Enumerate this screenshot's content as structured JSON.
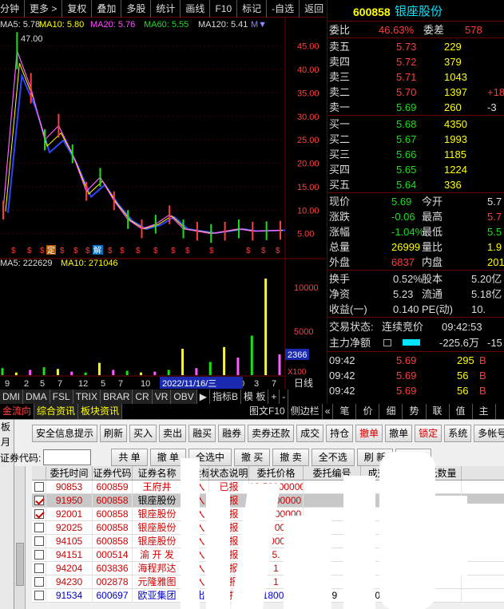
{
  "topbar": {
    "items": [
      "分钟",
      "更多 >",
      "复权",
      "叠加",
      "多股",
      "统计",
      "画线",
      "F10",
      "标记",
      "-自选",
      "返回"
    ]
  },
  "ma": {
    "ma5": "MA5: 5.78",
    "ma10": "MA10: 5.80",
    "ma20": "MA20: 5.76",
    "ma60": "MA60: 5.55",
    "ma120": "MA120: 5.41",
    "more": "M▼"
  },
  "chart_data": {
    "type": "line",
    "price_high_label": "47.00",
    "yaxis_price": [
      "45.00",
      "40.00",
      "35.00",
      "30.00",
      "25.00",
      "20.00",
      "15.00",
      "10.00",
      "5.00"
    ],
    "yaxis_volume": [
      "10000",
      "5000",
      "2366"
    ],
    "volume_unit": "X100",
    "vol_ma": {
      "ma5": "MA5: 222629",
      "ma10": "MA10: 271046"
    },
    "xaxis": [
      "9",
      "2",
      "5",
      "7",
      "12",
      "5",
      "7",
      "10",
      "12",
      "5",
      "7",
      "10",
      "3",
      "7"
    ],
    "date_label": "2022/11/16/三",
    "period_label": "日线",
    "marker_label_ding": "定",
    "marker_label_jie": "解",
    "price_series": [
      10,
      44,
      36,
      25,
      28,
      22,
      14,
      17,
      12,
      8,
      6,
      7,
      9,
      6,
      5.5,
      5,
      5.5,
      6,
      5.5,
      5.6,
      5.7
    ],
    "volume_series": [
      800,
      300,
      600,
      900,
      700,
      400,
      300,
      1400,
      600,
      500,
      300,
      400,
      600,
      3000,
      800,
      1500,
      3200,
      2000,
      4500,
      11000,
      2366
    ]
  },
  "ctrlbar": {
    "items": [
      "DMI",
      "DMA",
      "FSL",
      "TRIX",
      "BRAR",
      "CR",
      "VR",
      "OBV",
      "▶",
      "指标B",
      "模 板",
      "+",
      "-"
    ]
  },
  "tabbar": {
    "items": [
      "金流向",
      "综合资讯",
      "板块资讯",
      "图文F10",
      "侧边栏",
      "«",
      "笔",
      "价",
      "细",
      "势",
      "联",
      "值",
      "主"
    ]
  },
  "quote": {
    "code": "600858",
    "name": "银座股份",
    "weibi_label": "委比",
    "weibi_value": "46.63%",
    "weicha_label": "委差",
    "weicha_value": "578",
    "asks": [
      {
        "label": "卖五",
        "price": "5.73",
        "vol": "229",
        "chg": ""
      },
      {
        "label": "卖四",
        "price": "5.72",
        "vol": "379",
        "chg": ""
      },
      {
        "label": "卖三",
        "price": "5.71",
        "vol": "1043",
        "chg": ""
      },
      {
        "label": "卖二",
        "price": "5.70",
        "vol": "1397",
        "chg": "+18"
      },
      {
        "label": "卖一",
        "price": "5.69",
        "vol": "260",
        "chg": "-3"
      }
    ],
    "bids": [
      {
        "label": "买一",
        "price": "5.68",
        "vol": "4350"
      },
      {
        "label": "买二",
        "price": "5.67",
        "vol": "1993"
      },
      {
        "label": "买三",
        "price": "5.66",
        "vol": "1185"
      },
      {
        "label": "买四",
        "price": "5.65",
        "vol": "1224"
      },
      {
        "label": "买五",
        "price": "5.64",
        "vol": "336"
      }
    ],
    "stats": [
      {
        "l1": "现价",
        "v1": "5.69",
        "l2": "今开",
        "v2": "5.7"
      },
      {
        "l1": "涨跌",
        "v1": "-0.06",
        "l2": "最高",
        "v2": "5.7"
      },
      {
        "l1": "涨幅",
        "v1": "-1.04%",
        "l2": "最低",
        "v2": "5.5"
      },
      {
        "l1": "总量",
        "v1": "26999",
        "l2": "量比",
        "v2": "1.9"
      },
      {
        "l1": "外盘",
        "v1": "6837",
        "l2": "内盘",
        "v2": "2016"
      }
    ],
    "stats2": [
      {
        "l1": "换手",
        "v1": "0.52%",
        "l2": "股本",
        "v2": "5.20亿"
      },
      {
        "l1": "净资",
        "v1": "5.23",
        "l2": "流通",
        "v2": "5.18亿"
      },
      {
        "l1": "收益(一)",
        "v1": "0.140",
        "l2": "PE(动)",
        "v2": "10."
      }
    ],
    "trade_status_label": "交易状态:",
    "trade_status_value": "连续竞价",
    "trade_status_time": "09:42:53",
    "mainflow_label": "主力净额",
    "mainflow_value": "-225.6万",
    "mainflow_extra": "-15",
    "ticks": [
      {
        "time": "09:42",
        "price": "5.69",
        "vol": "295",
        "dir": "B"
      },
      {
        "time": "09:42",
        "price": "5.69",
        "vol": "56",
        "dir": "B"
      },
      {
        "time": "09:42",
        "price": "5.69",
        "vol": "56",
        "dir": "B"
      }
    ]
  },
  "trade": {
    "leftstrip": [
      "板",
      "月"
    ],
    "buttons1": [
      "安全信息提示",
      "刷新",
      "买入",
      "卖出",
      "融买",
      "融券",
      "卖券还款",
      "成交",
      "持仓",
      "撤单",
      "撤单",
      "锁定",
      "系统",
      "多帐号"
    ],
    "code_label": "证券代码:",
    "code_value": "",
    "buttons2": [
      "共 单",
      "撤 单",
      "全选中",
      "撤 买",
      "撤 卖",
      "全不选",
      "刷 新",
      "输 出"
    ],
    "headers": [
      "",
      "委托时间",
      "证券代码",
      "证券名称",
      "买卖标志",
      "状态说明",
      "委托价格",
      "委托编号",
      "成交价格",
      "委托数量"
    ],
    "rows": [
      {
        "checked": false,
        "time": "90853",
        "code": "600859",
        "name": "王府井",
        "side": "买入",
        "status": "已报",
        "price": "13.52000000",
        "id": "",
        "deal": "",
        "qty": "",
        "sel": false
      },
      {
        "checked": true,
        "time": "91950",
        "code": "600858",
        "name": "银座股份",
        "side": "买入",
        "status": "已报",
        "price": "5.68000000",
        "id": "",
        "deal": "",
        "qty": "",
        "sel": true
      },
      {
        "checked": true,
        "time": "92001",
        "code": "600858",
        "name": "银座股份",
        "side": "买入",
        "status": "已报",
        "price": "5.65000000",
        "id": "",
        "deal": "",
        "qty": "",
        "sel": false
      },
      {
        "checked": false,
        "time": "92025",
        "code": "600858",
        "name": "银座股份",
        "side": "买入",
        "status": "已报",
        "price": "5.61000000",
        "id": "",
        "deal": "",
        "qty": "",
        "sel": false
      },
      {
        "checked": false,
        "time": "94105",
        "code": "600858",
        "name": "银座股份",
        "side": "买入",
        "status": "已报",
        "price": "5.55000000",
        "id": "",
        "deal": "",
        "qty": "",
        "sel": false
      },
      {
        "checked": false,
        "time": "94151",
        "code": "000514",
        "name": "渝 开 发",
        "side": "买入",
        "status": "已报",
        "price": "5.",
        "id": "",
        "deal": "",
        "qty": "",
        "sel": false
      },
      {
        "checked": false,
        "time": "94204",
        "code": "603836",
        "name": "海程邦达",
        "side": "买入",
        "status": "已报",
        "price": "1",
        "id": "",
        "deal": "",
        "qty": "",
        "sel": false
      },
      {
        "checked": false,
        "time": "94230",
        "code": "002878",
        "name": "元隆雅图",
        "side": "买入",
        "status": "已报",
        "price": "1",
        "id": "",
        "deal": "",
        "qty": "",
        "sel": false
      },
      {
        "checked": false,
        "time": "91534",
        "code": "600697",
        "name": "欧亚集团",
        "side": "卖出",
        "status": "已报",
        "price": "13.18000000",
        "id": "89",
        "deal": "0.00000000",
        "qty": "",
        "sel": false
      }
    ]
  }
}
